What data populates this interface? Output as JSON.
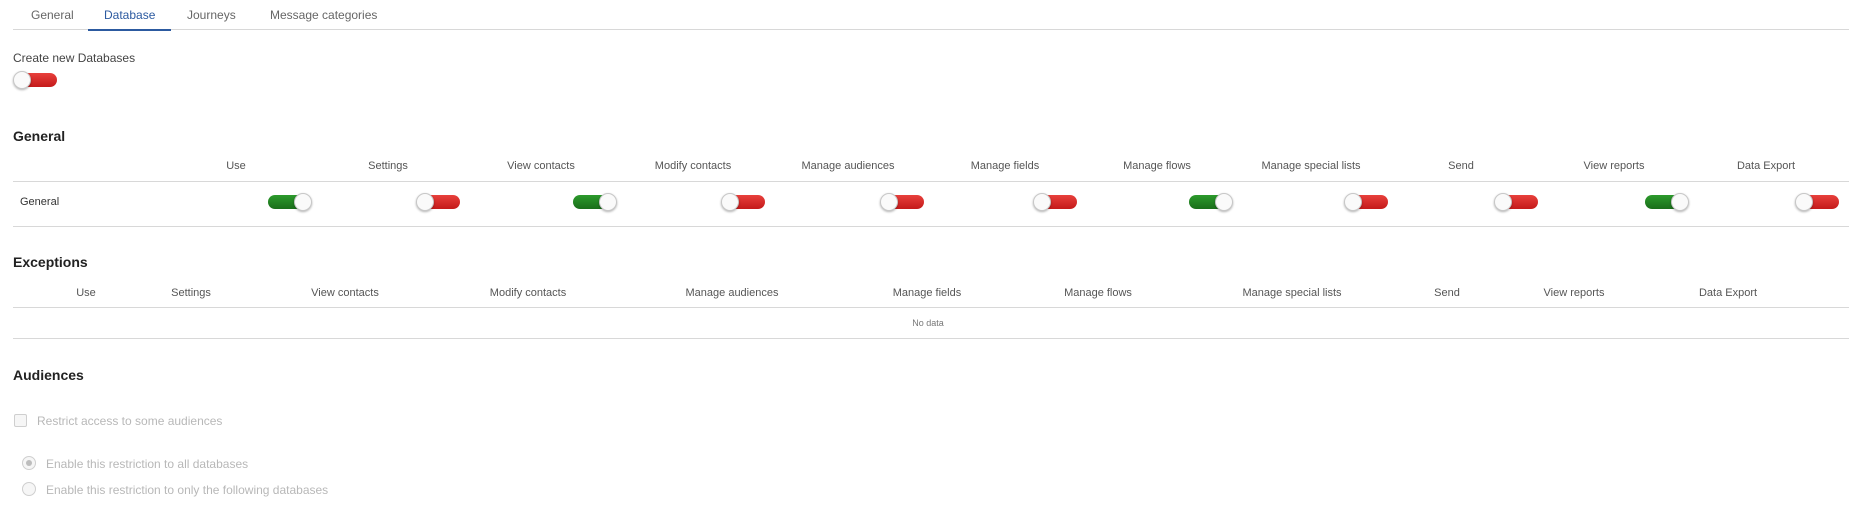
{
  "tabs": [
    {
      "label": "General",
      "active": false
    },
    {
      "label": "Database",
      "active": true
    },
    {
      "label": "Journeys",
      "active": false
    },
    {
      "label": "Message categories",
      "active": false
    }
  ],
  "create_new": {
    "label": "Create new Databases",
    "enabled": false
  },
  "general_section": {
    "title": "General",
    "columns": [
      "Use",
      "Settings",
      "View contacts",
      "Modify contacts",
      "Manage audiences",
      "Manage fields",
      "Manage flows",
      "Manage special lists",
      "Send",
      "View reports",
      "Data Export"
    ],
    "row": {
      "label": "General",
      "values": [
        true,
        false,
        true,
        false,
        false,
        false,
        true,
        false,
        false,
        true,
        false
      ]
    }
  },
  "exceptions_section": {
    "title": "Exceptions",
    "columns": [
      "Use",
      "Settings",
      "View contacts",
      "Modify contacts",
      "Manage audiences",
      "Manage fields",
      "Manage flows",
      "Manage special lists",
      "Send",
      "View reports",
      "Data Export"
    ],
    "empty_text": "No data"
  },
  "audiences_section": {
    "title": "Audiences",
    "restrict_label": "Restrict access to some audiences",
    "radio_all_label": "Enable this restriction to all databases",
    "radio_some_label": "Enable this restriction to only the following databases"
  },
  "colors": {
    "accent": "#2c5aa0",
    "toggle_on": "#1f7f1f",
    "toggle_off": "#d42a27"
  }
}
